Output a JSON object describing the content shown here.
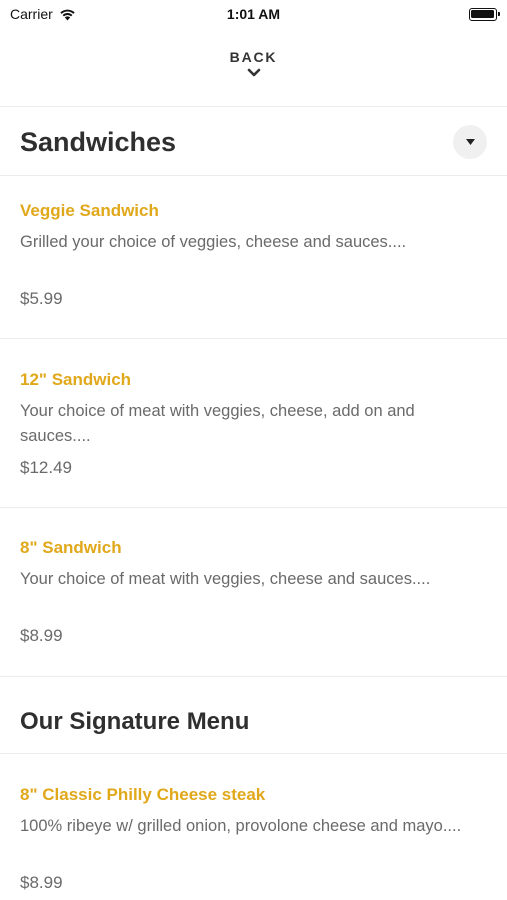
{
  "status_bar": {
    "carrier": "Carrier",
    "time": "1:01 AM"
  },
  "header": {
    "back_label": "BACK"
  },
  "category": {
    "title": "Sandwiches"
  },
  "items": [
    {
      "name": "Veggie Sandwich",
      "description": "Grilled your choice of veggies, cheese and sauces....",
      "price": "$5.99"
    },
    {
      "name": "12\" Sandwich",
      "description": "Your choice of meat with veggies, cheese, add on and sauces....",
      "price": "$12.49"
    },
    {
      "name": "8\" Sandwich",
      "description": "Your choice of meat with veggies, cheese and sauces....",
      "price": "$8.99"
    }
  ],
  "signature_section": {
    "title": "Our Signature Menu",
    "items": [
      {
        "name": "8\" Classic Philly Cheese steak",
        "description": "100% ribeye w/ grilled onion, provolone cheese and mayo....",
        "price": "$8.99"
      }
    ]
  },
  "colors": {
    "accent": "#e0a81a",
    "text_muted": "#6a6a6a",
    "divider": "#ececec"
  }
}
